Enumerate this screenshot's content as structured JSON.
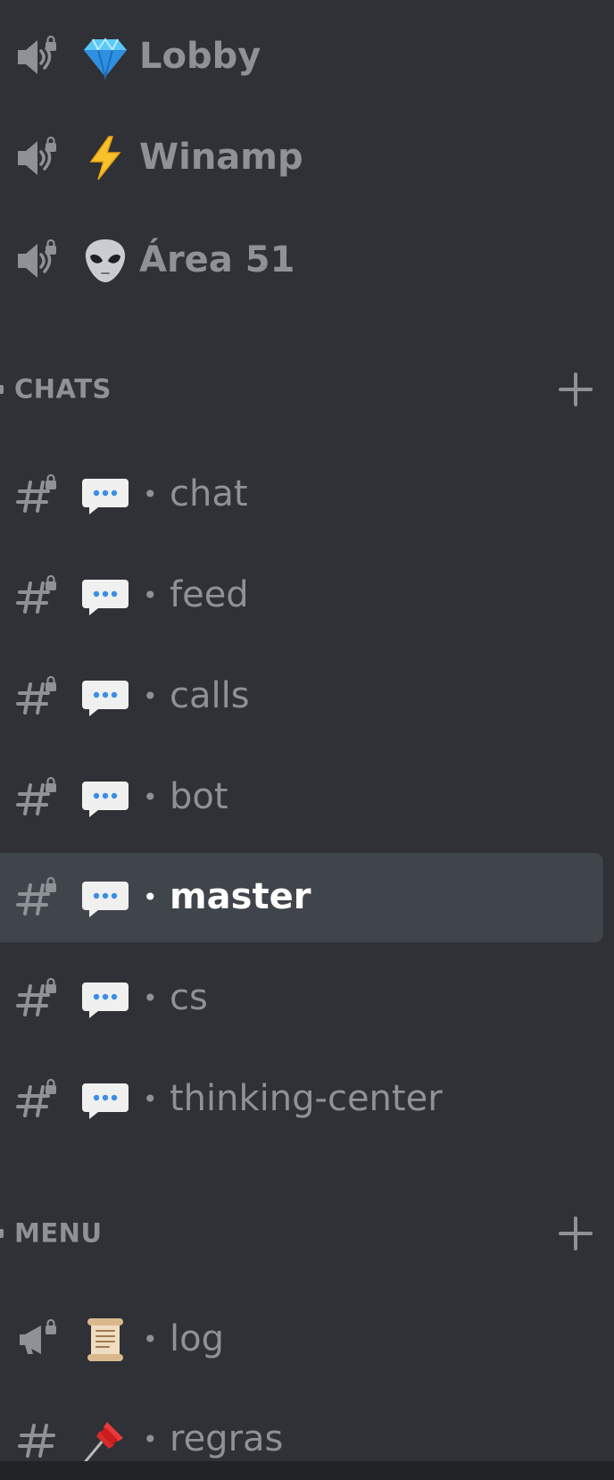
{
  "voice_channels": [
    {
      "name": "Lobby",
      "emoji": "gem-stone-emoji"
    },
    {
      "name": "Winamp",
      "emoji": "high-voltage-emoji"
    },
    {
      "name": "Área 51",
      "emoji": "alien-emoji"
    }
  ],
  "categories": {
    "chats": {
      "label": "CHATS",
      "add_icon": "plus-icon",
      "channels": [
        {
          "name": "chat",
          "separator": "•"
        },
        {
          "name": "feed",
          "separator": "•"
        },
        {
          "name": "calls",
          "separator": "•"
        },
        {
          "name": "bot",
          "separator": "•"
        },
        {
          "name": "master",
          "separator": "•",
          "selected": true
        },
        {
          "name": "cs",
          "separator": "•"
        },
        {
          "name": "thinking-center",
          "separator": "•"
        }
      ]
    },
    "menu": {
      "label": "MENU",
      "add_icon": "plus-icon",
      "channels": [
        {
          "name": "log",
          "separator": "•",
          "icon": "locked-announcement-icon",
          "emoji": "scroll-emoji"
        },
        {
          "name": "regras",
          "separator": "•",
          "icon": "text-channel-icon",
          "emoji": "pushpin-emoji"
        }
      ]
    }
  },
  "colors": {
    "background": "#2f3136",
    "selected_row": "#40444b",
    "muted_text": "#8e9297",
    "selected_text": "#ffffff",
    "bottom_bar": "#202225"
  }
}
